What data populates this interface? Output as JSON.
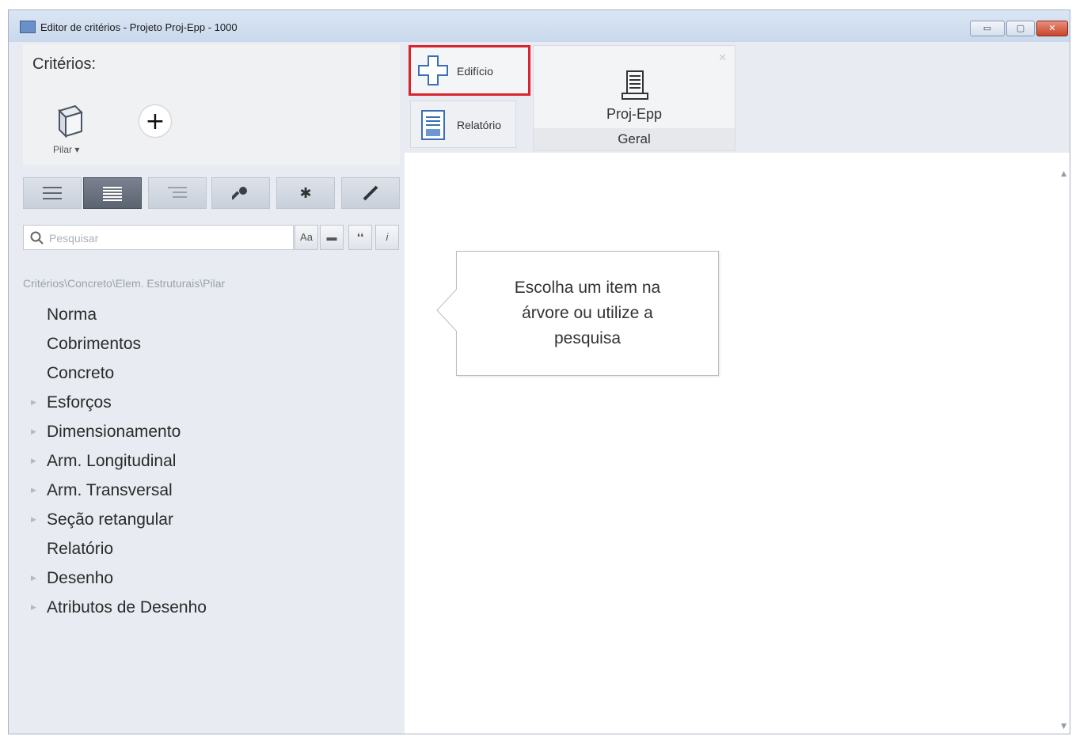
{
  "window": {
    "title": "Editor de critérios - Projeto Proj-Epp - 1000",
    "controls": {
      "minimize": "▭",
      "maximize": "▢",
      "close": "✕"
    }
  },
  "criteria": {
    "title": "Critérios:",
    "element_label": "Pilar ▾",
    "add_icon": "plus-icon"
  },
  "view_toolbar": {
    "buttons": [
      "list-icon",
      "detail-list-icon",
      "tree-icon",
      "wrench-icon",
      "asterisk-icon",
      "pencil-icon"
    ],
    "active": "detail-list-icon"
  },
  "search": {
    "placeholder": "Pesquisar",
    "options": [
      "Aa",
      "▬",
      "❛❛",
      "i"
    ]
  },
  "breadcrumb": "Critérios\\Concreto\\Elem. Estruturais\\Pilar",
  "tree": [
    {
      "label": "Norma",
      "expandable": false
    },
    {
      "label": "Cobrimentos",
      "expandable": false
    },
    {
      "label": "Concreto",
      "expandable": false
    },
    {
      "label": "Esforços",
      "expandable": true
    },
    {
      "label": "Dimensionamento",
      "expandable": true
    },
    {
      "label": "Arm. Longitudinal",
      "expandable": true
    },
    {
      "label": "Arm. Transversal",
      "expandable": true
    },
    {
      "label": "Seção retangular",
      "expandable": true
    },
    {
      "label": "Relatório",
      "expandable": false
    },
    {
      "label": "Desenho",
      "expandable": true
    },
    {
      "label": "Atributos de Desenho",
      "expandable": true
    }
  ],
  "tabs": {
    "edificio": "Edifício",
    "relatorio": "Relatório"
  },
  "project_card": {
    "name": "Proj-Epp",
    "subtitle": "Geral",
    "close": "✕"
  },
  "hint": "Escolha um item na árvore ou utilize a pesquisa",
  "colors": {
    "highlight": "#d9232e",
    "active_view": "#5c6370"
  }
}
